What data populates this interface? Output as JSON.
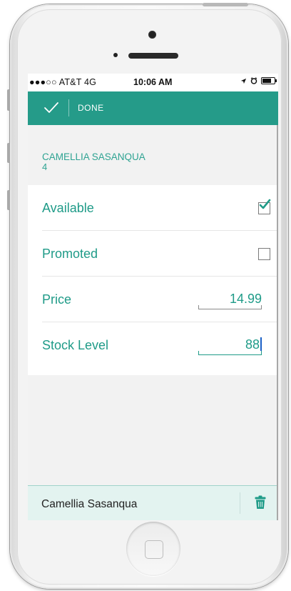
{
  "status_bar": {
    "carrier": "●●●○○ AT&T  4G",
    "time": "10:06 AM"
  },
  "nav": {
    "done_label": "DONE"
  },
  "product": {
    "name": "CAMELLIA SASANQUA",
    "subtitle": "4"
  },
  "form": {
    "available_label": "Available",
    "available_checked": true,
    "promoted_label": "Promoted",
    "promoted_checked": false,
    "price_label": "Price",
    "price_value": "14.99",
    "stock_label": "Stock Level",
    "stock_value": "88"
  },
  "bottom_bar": {
    "item_name": "Camellia Sasanqua"
  },
  "colors": {
    "accent": "#259b89",
    "accent_text": "#1f9b88",
    "bottom_bar_bg": "#e3f3f0"
  },
  "icons": {
    "done": "checkmark-icon",
    "delete": "trash-icon"
  }
}
